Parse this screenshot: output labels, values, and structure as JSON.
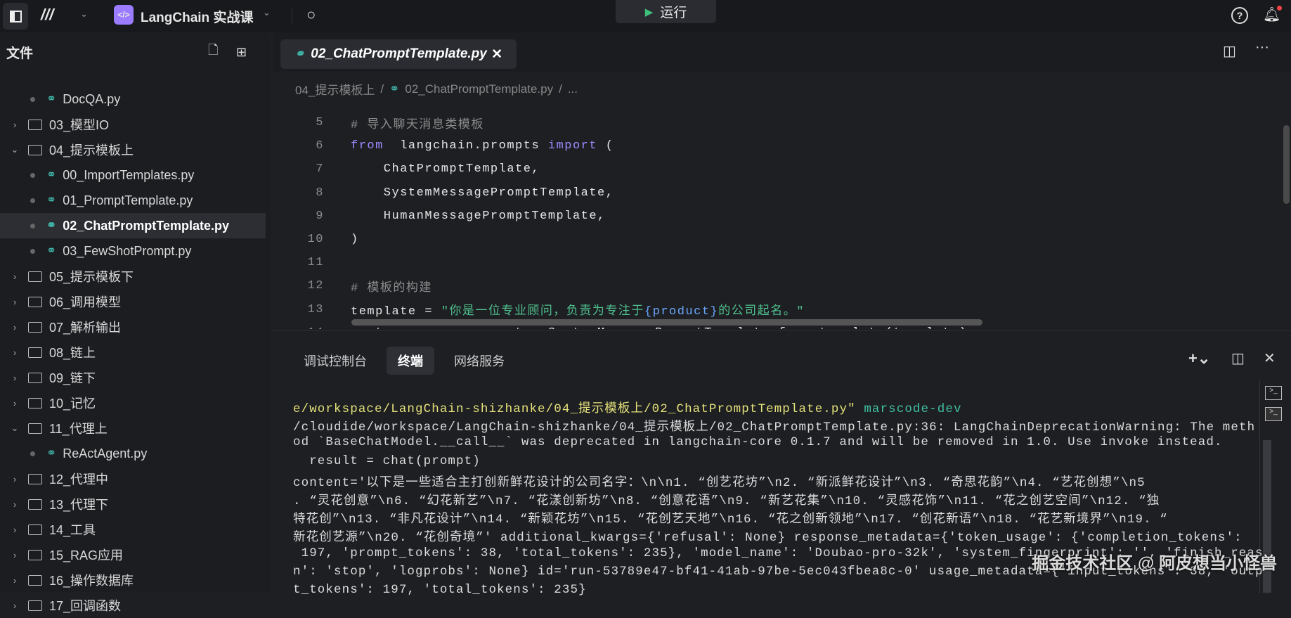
{
  "topbar": {
    "project": "LangChain 实战课",
    "run_label": "运行"
  },
  "sidebar": {
    "title": "文件",
    "items": [
      {
        "type": "file",
        "label": "DocQA.py",
        "depth": 1
      },
      {
        "type": "folder",
        "label": "03_模型IO",
        "open": false
      },
      {
        "type": "folder",
        "label": "04_提示模板上",
        "open": true
      },
      {
        "type": "file",
        "label": "00_ImportTemplates.py",
        "depth": 1
      },
      {
        "type": "file",
        "label": "01_PromptTemplate.py",
        "depth": 1
      },
      {
        "type": "file",
        "label": "02_ChatPromptTemplate.py",
        "depth": 1,
        "selected": true
      },
      {
        "type": "file",
        "label": "03_FewShotPrompt.py",
        "depth": 1
      },
      {
        "type": "folder",
        "label": "05_提示模板下",
        "open": false
      },
      {
        "type": "folder",
        "label": "06_调用模型",
        "open": false
      },
      {
        "type": "folder",
        "label": "07_解析输出",
        "open": false
      },
      {
        "type": "folder",
        "label": "08_链上",
        "open": false
      },
      {
        "type": "folder",
        "label": "09_链下",
        "open": false
      },
      {
        "type": "folder",
        "label": "10_记忆",
        "open": false
      },
      {
        "type": "folder",
        "label": "11_代理上",
        "open": true
      },
      {
        "type": "file",
        "label": "ReActAgent.py",
        "depth": 1
      },
      {
        "type": "folder",
        "label": "12_代理中",
        "open": false
      },
      {
        "type": "folder",
        "label": "13_代理下",
        "open": false
      },
      {
        "type": "folder",
        "label": "14_工具",
        "open": false
      },
      {
        "type": "folder",
        "label": "15_RAG应用",
        "open": false
      },
      {
        "type": "folder",
        "label": "16_操作数据库",
        "open": false
      },
      {
        "type": "folder",
        "label": "17_回调函数",
        "open": false
      }
    ]
  },
  "editor": {
    "tab": "02_ChatPromptTemplate.py",
    "breadcrumb": [
      "04_提示模板上",
      "02_ChatPromptTemplate.py",
      "..."
    ],
    "lines": [
      {
        "n": "5",
        "parts": [
          [
            "cm",
            "# 导入聊天消息类模板"
          ]
        ]
      },
      {
        "n": "6",
        "parts": [
          [
            "kw",
            "from"
          ],
          [
            "",
            "  langchain.prompts "
          ],
          [
            "kw",
            "import"
          ],
          [
            "",
            " ("
          ]
        ]
      },
      {
        "n": "7",
        "parts": [
          [
            "",
            "    ChatPromptTemplate,"
          ]
        ]
      },
      {
        "n": "8",
        "parts": [
          [
            "",
            "    SystemMessagePromptTemplate,"
          ]
        ]
      },
      {
        "n": "9",
        "parts": [
          [
            "",
            "    HumanMessagePromptTemplate,"
          ]
        ]
      },
      {
        "n": "10",
        "parts": [
          [
            "",
            ")"
          ]
        ]
      },
      {
        "n": "11",
        "parts": []
      },
      {
        "n": "12",
        "parts": [
          [
            "cm",
            "# 模板的构建"
          ]
        ]
      },
      {
        "n": "13",
        "parts": [
          [
            "",
            "template = "
          ],
          [
            "st",
            "\"你是一位专业顾问，负责为专注于"
          ],
          [
            "br",
            "{product}"
          ],
          [
            "st",
            "的公司起名。\""
          ]
        ]
      },
      {
        "n": "14",
        "parts": [
          [
            "",
            "system_message_prompt = SystemMessagePromptTemplate.from_template(template)"
          ]
        ]
      }
    ]
  },
  "panel": {
    "tabs": [
      "调试控制台",
      "终端",
      "网络服务"
    ],
    "active": 1,
    "terminal": [
      [
        [
          "yl",
          "e/workspace/LangChain-shizhanke/04_提示模板上/02_ChatPromptTemplate.py\""
        ],
        [
          "gr",
          " marscode-dev"
        ]
      ],
      [
        [
          "",
          "/cloudide/workspace/LangChain-shizhanke/04_提示模板上/02_ChatPromptTemplate.py:36: LangChainDeprecationWarning: The meth"
        ]
      ],
      [
        [
          "",
          "od `BaseChatModel.__call__` was deprecated in langchain-core 0.1.7 and will be removed in 1.0. Use invoke instead."
        ]
      ],
      [
        [
          "",
          "  result = chat(prompt)"
        ]
      ],
      [
        [
          "",
          "content='以下是一些适合主打创新鲜花设计的公司名字：\\n\\n1. “创艺花坊”\\n2. “新派鲜花设计”\\n3. “奇思花韵”\\n4. “艺花创想”\\n5"
        ]
      ],
      [
        [
          "",
          ". “灵花创意”\\n6. “幻花新艺”\\n7. “花漾创新坊”\\n8. “创意花语”\\n9. “新艺花集”\\n10. “灵感花饰”\\n11. “花之创艺空间”\\n12. “独"
        ]
      ],
      [
        [
          "",
          "特花创”\\n13. “非凡花设计”\\n14. “新颖花坊”\\n15. “花创艺天地”\\n16. “花之创新领地”\\n17. “创花新语”\\n18. “花艺新境界”\\n19. “"
        ]
      ],
      [
        [
          "",
          "新花创艺源”\\n20. “花创奇境”' additional_kwargs={'refusal': None} response_metadata={'token_usage': {'completion_tokens':"
        ]
      ],
      [
        [
          "",
          " 197, 'prompt_tokens': 38, 'total_tokens': 235}, 'model_name': 'Doubao-pro-32k', 'system_fingerprint': '', 'finish_reaso"
        ]
      ],
      [
        [
          "",
          "n': 'stop', 'logprobs': None} id='run-53789e47-bf41-41ab-97be-5ec043fbea8c-0' usage_metadata={'input_tokens': 38, 'outpu"
        ]
      ],
      [
        [
          "",
          "t_tokens': 197, 'total_tokens': 235}"
        ]
      ]
    ]
  },
  "watermark": "掘金技术社区 @ 阿皮想当小怪兽"
}
